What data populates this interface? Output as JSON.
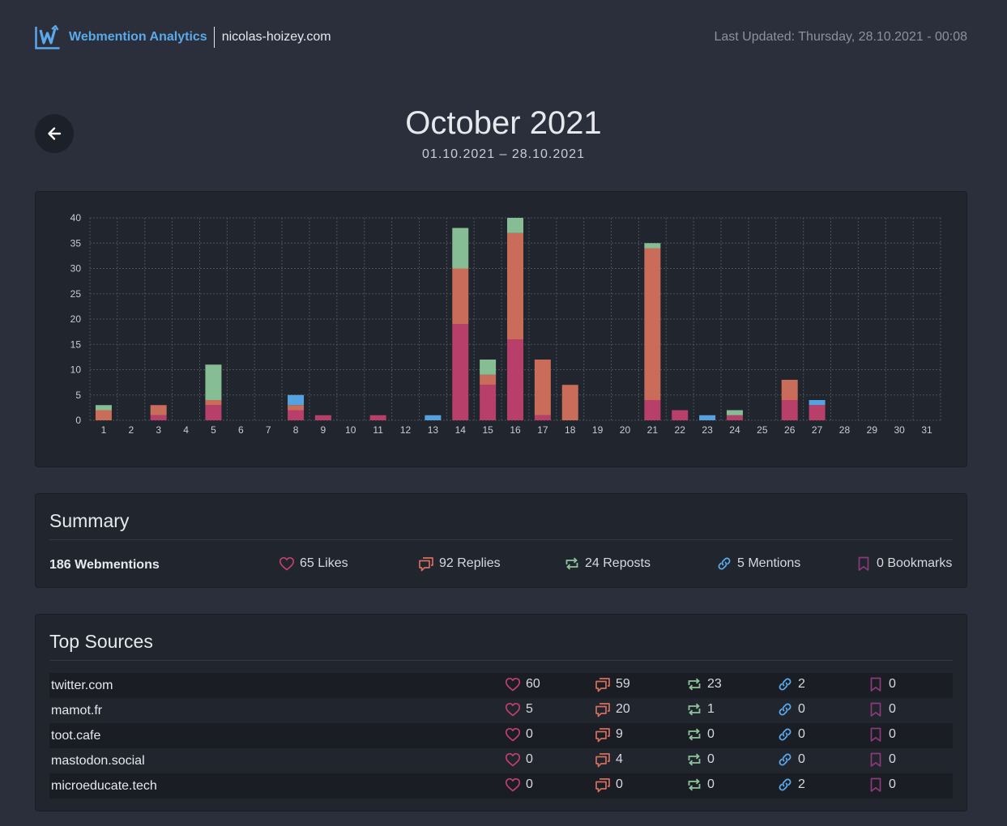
{
  "header": {
    "brand": "Webmention Analytics",
    "domain": "nicolas-hoizey.com",
    "last_updated": "Last Updated: Thursday, 28.10.2021 - 00:08"
  },
  "page": {
    "title": "October 2021",
    "date_range": "01.10.2021 – 28.10.2021"
  },
  "colors": {
    "like": "#c0406e",
    "reply": "#d4705d",
    "repost": "#8dc59a",
    "mention": "#5aa9ea",
    "bookmark": "#8a3b7a"
  },
  "chart_data": {
    "type": "bar",
    "stacked": true,
    "categories": [
      "1",
      "2",
      "3",
      "4",
      "5",
      "6",
      "7",
      "8",
      "9",
      "10",
      "11",
      "12",
      "13",
      "14",
      "15",
      "16",
      "17",
      "18",
      "19",
      "20",
      "21",
      "22",
      "23",
      "24",
      "25",
      "26",
      "27",
      "28",
      "29",
      "30",
      "31"
    ],
    "ylim": [
      0,
      40
    ],
    "yticks": [
      "0",
      "5",
      "10",
      "15",
      "20",
      "25",
      "30",
      "35",
      "40"
    ],
    "grid": true,
    "series": [
      {
        "key": "likes",
        "color": "#c0406e",
        "values": [
          0,
          0,
          1,
          0,
          3,
          0,
          0,
          2,
          1,
          0,
          1,
          0,
          0,
          19,
          7,
          16,
          1,
          0,
          0,
          0,
          4,
          2,
          0,
          1,
          0,
          4,
          3,
          0,
          0,
          0,
          0
        ]
      },
      {
        "key": "replies",
        "color": "#d4705d",
        "values": [
          2,
          0,
          2,
          0,
          1,
          0,
          0,
          1,
          0,
          0,
          0,
          0,
          0,
          11,
          2,
          21,
          11,
          7,
          0,
          0,
          30,
          0,
          0,
          0,
          0,
          4,
          0,
          0,
          0,
          0,
          0
        ]
      },
      {
        "key": "reposts",
        "color": "#8dc59a",
        "values": [
          1,
          0,
          0,
          0,
          7,
          0,
          0,
          0,
          0,
          0,
          0,
          0,
          0,
          8,
          3,
          3,
          0,
          0,
          0,
          0,
          1,
          0,
          0,
          1,
          0,
          0,
          0,
          0,
          0,
          0,
          0
        ]
      },
      {
        "key": "mentions",
        "color": "#5aa9ea",
        "values": [
          0,
          0,
          0,
          0,
          0,
          0,
          0,
          2,
          0,
          0,
          0,
          0,
          1,
          0,
          0,
          0,
          0,
          0,
          0,
          0,
          0,
          0,
          1,
          0,
          0,
          0,
          1,
          0,
          0,
          0,
          0
        ]
      }
    ]
  },
  "summary": {
    "title": "Summary",
    "total": "186 Webmentions",
    "likes": "65 Likes",
    "replies": "92 Replies",
    "reposts": "24 Reposts",
    "mentions": "5 Mentions",
    "bookmarks": "0 Bookmarks"
  },
  "sources": {
    "title": "Top Sources",
    "rows": [
      {
        "name": "twitter.com",
        "likes": "60",
        "replies": "59",
        "reposts": "23",
        "mentions": "2",
        "bookmarks": "0"
      },
      {
        "name": "mamot.fr",
        "likes": "5",
        "replies": "20",
        "reposts": "1",
        "mentions": "0",
        "bookmarks": "0"
      },
      {
        "name": "toot.cafe",
        "likes": "0",
        "replies": "9",
        "reposts": "0",
        "mentions": "0",
        "bookmarks": "0"
      },
      {
        "name": "mastodon.social",
        "likes": "0",
        "replies": "4",
        "reposts": "0",
        "mentions": "0",
        "bookmarks": "0"
      },
      {
        "name": "microeducate.tech",
        "likes": "0",
        "replies": "0",
        "reposts": "0",
        "mentions": "2",
        "bookmarks": "0"
      }
    ]
  }
}
